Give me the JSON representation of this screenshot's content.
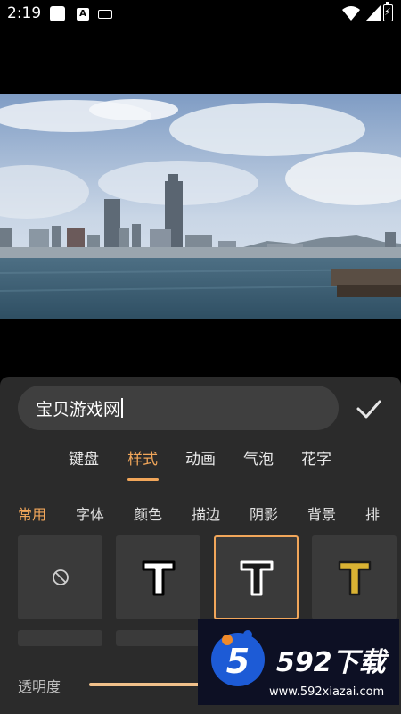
{
  "status_bar": {
    "time": "2:19",
    "icons": [
      "square-notification-icon",
      "a-notification-icon",
      "keyboard-icon",
      "wifi-icon",
      "signal-icon",
      "battery-charging-icon"
    ]
  },
  "editor": {
    "text_value": "宝贝游戏网",
    "confirm_icon": "checkmark-icon",
    "main_tabs": [
      {
        "label": "键盘",
        "active": false
      },
      {
        "label": "样式",
        "active": true
      },
      {
        "label": "动画",
        "active": false
      },
      {
        "label": "气泡",
        "active": false
      },
      {
        "label": "花字",
        "active": false
      }
    ],
    "sub_tabs": [
      {
        "label": "常用",
        "active": true
      },
      {
        "label": "字体",
        "active": false
      },
      {
        "label": "颜色",
        "active": false
      },
      {
        "label": "描边",
        "active": false
      },
      {
        "label": "阴影",
        "active": false
      },
      {
        "label": "背景",
        "active": false
      },
      {
        "label": "排",
        "active": false
      }
    ],
    "style_tiles": [
      {
        "name": "none",
        "icon": "no-style-icon",
        "selected": false
      },
      {
        "name": "white-black-outline",
        "glyph": "T",
        "selected": false
      },
      {
        "name": "black-white-outline",
        "glyph": "T",
        "selected": true
      },
      {
        "name": "gold",
        "glyph": "T",
        "selected": false
      }
    ],
    "opacity": {
      "label": "透明度",
      "value_fraction": 0.4
    }
  },
  "colors": {
    "accent": "#f1a65a",
    "panel_bg": "#2b2b2b",
    "tile_bg": "#3a3a3a"
  },
  "watermark": {
    "digit": "5",
    "brand": "592下载",
    "url": "www.592xiazai.com"
  }
}
